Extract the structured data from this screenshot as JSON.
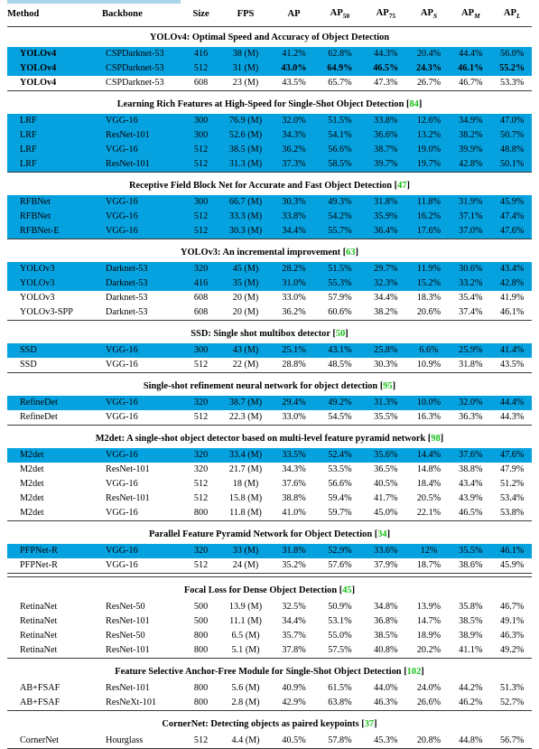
{
  "table": {
    "columns": [
      {
        "key": "method",
        "label": "Method",
        "align": "left"
      },
      {
        "key": "backbone",
        "label": "Backbone",
        "align": "left"
      },
      {
        "key": "size",
        "label": "Size",
        "align": "center"
      },
      {
        "key": "fps",
        "label": "FPS",
        "align": "center"
      },
      {
        "key": "ap",
        "label": "AP",
        "align": "center"
      },
      {
        "key": "ap50",
        "label": "AP",
        "sub": "50",
        "align": "center"
      },
      {
        "key": "ap75",
        "label": "AP",
        "sub": "75",
        "align": "center"
      },
      {
        "key": "aps",
        "label": "AP",
        "sub_italic": "S",
        "align": "center"
      },
      {
        "key": "apm",
        "label": "AP",
        "sub_italic": "M",
        "align": "center"
      },
      {
        "key": "apl",
        "label": "AP",
        "sub_italic": "L",
        "align": "center"
      }
    ],
    "sections": [
      {
        "title": "YOLOv4: Optimal Speed and Accuracy of Object Detection",
        "citation": "",
        "rows": [
          {
            "method": "YOLOv4",
            "backbone": "CSPDarknet-53",
            "size": "416",
            "fps": "38 (M)",
            "ap": "41.2%",
            "ap50": "62.8%",
            "ap75": "44.3%",
            "aps": "20.4%",
            "apm": "44.4%",
            "apl": "56.0%",
            "highlight": true,
            "bold": "method"
          },
          {
            "method": "YOLOv4",
            "backbone": "CSPDarknet-53",
            "size": "512",
            "fps": "31 (M)",
            "ap": "43.0%",
            "ap50": "64.9%",
            "ap75": "46.5%",
            "aps": "24.3%",
            "apm": "46.1%",
            "apl": "55.2%",
            "highlight": true,
            "bold": "all"
          },
          {
            "method": "YOLOv4",
            "backbone": "CSPDarknet-53",
            "size": "608",
            "fps": "23 (M)",
            "ap": "43.5%",
            "ap50": "65.7%",
            "ap75": "47.3%",
            "aps": "26.7%",
            "apm": "46.7%",
            "apl": "53.3%",
            "highlight": false,
            "bold": "method"
          }
        ]
      },
      {
        "title": "Learning Rich Features at High-Speed for Single-Shot Object Detection",
        "citation": "84",
        "rows": [
          {
            "method": "LRF",
            "backbone": "VGG-16",
            "size": "300",
            "fps": "76.9 (M)",
            "ap": "32.0%",
            "ap50": "51.5%",
            "ap75": "33.8%",
            "aps": "12.6%",
            "apm": "34.9%",
            "apl": "47.0%",
            "highlight": true
          },
          {
            "method": "LRF",
            "backbone": "ResNet-101",
            "size": "300",
            "fps": "52.6 (M)",
            "ap": "34.3%",
            "ap50": "54.1%",
            "ap75": "36.6%",
            "aps": "13.2%",
            "apm": "38.2%",
            "apl": "50.7%",
            "highlight": true
          },
          {
            "method": "LRF",
            "backbone": "VGG-16",
            "size": "512",
            "fps": "38.5 (M)",
            "ap": "36.2%",
            "ap50": "56.6%",
            "ap75": "38.7%",
            "aps": "19.0%",
            "apm": "39.9%",
            "apl": "48.8%",
            "highlight": true
          },
          {
            "method": "LRF",
            "backbone": "ResNet-101",
            "size": "512",
            "fps": "31.3 (M)",
            "ap": "37.3%",
            "ap50": "58.5%",
            "ap75": "39.7%",
            "aps": "19.7%",
            "apm": "42.8%",
            "apl": "50.1%",
            "highlight": true
          }
        ]
      },
      {
        "title": "Receptive Field Block Net for Accurate and Fast Object Detection",
        "citation": "47",
        "rows": [
          {
            "method": "RFBNet",
            "backbone": "VGG-16",
            "size": "300",
            "fps": "66.7 (M)",
            "ap": "30.3%",
            "ap50": "49.3%",
            "ap75": "31.8%",
            "aps": "11.8%",
            "apm": "31.9%",
            "apl": "45.9%",
            "highlight": true
          },
          {
            "method": "RFBNet",
            "backbone": "VGG-16",
            "size": "512",
            "fps": "33.3 (M)",
            "ap": "33.8%",
            "ap50": "54.2%",
            "ap75": "35.9%",
            "aps": "16.2%",
            "apm": "37.1%",
            "apl": "47.4%",
            "highlight": true
          },
          {
            "method": "RFBNet-E",
            "backbone": "VGG-16",
            "size": "512",
            "fps": "30.3 (M)",
            "ap": "34.4%",
            "ap50": "55.7%",
            "ap75": "36.4%",
            "aps": "17.6%",
            "apm": "37.0%",
            "apl": "47.6%",
            "highlight": true
          }
        ]
      },
      {
        "title": "YOLOv3: An incremental improvement",
        "citation": "63",
        "rows": [
          {
            "method": "YOLOv3",
            "backbone": "Darknet-53",
            "size": "320",
            "fps": "45 (M)",
            "ap": "28.2%",
            "ap50": "51.5%",
            "ap75": "29.7%",
            "aps": "11.9%",
            "apm": "30.6%",
            "apl": "43.4%",
            "highlight": true
          },
          {
            "method": "YOLOv3",
            "backbone": "Darknet-53",
            "size": "416",
            "fps": "35 (M)",
            "ap": "31.0%",
            "ap50": "55.3%",
            "ap75": "32.3%",
            "aps": "15.2%",
            "apm": "33.2%",
            "apl": "42.8%",
            "highlight": true
          },
          {
            "method": "YOLOv3",
            "backbone": "Darknet-53",
            "size": "608",
            "fps": "20 (M)",
            "ap": "33.0%",
            "ap50": "57.9%",
            "ap75": "34.4%",
            "aps": "18.3%",
            "apm": "35.4%",
            "apl": "41.9%",
            "highlight": false
          },
          {
            "method": "YOLOv3-SPP",
            "backbone": "Darknet-53",
            "size": "608",
            "fps": "20 (M)",
            "ap": "36.2%",
            "ap50": "60.6%",
            "ap75": "38.2%",
            "aps": "20.6%",
            "apm": "37.4%",
            "apl": "46.1%",
            "highlight": false
          }
        ]
      },
      {
        "title": "SSD: Single shot multibox detector",
        "citation": "50",
        "rows": [
          {
            "method": "SSD",
            "backbone": "VGG-16",
            "size": "300",
            "fps": "43 (M)",
            "ap": "25.1%",
            "ap50": "43.1%",
            "ap75": "25.8%",
            "aps": "6.6%",
            "apm": "25.9%",
            "apl": "41.4%",
            "highlight": true
          },
          {
            "method": "SSD",
            "backbone": "VGG-16",
            "size": "512",
            "fps": "22 (M)",
            "ap": "28.8%",
            "ap50": "48.5%",
            "ap75": "30.3%",
            "aps": "10.9%",
            "apm": "31.8%",
            "apl": "43.5%",
            "highlight": false
          }
        ]
      },
      {
        "title": "Single-shot refinement neural network for object detection",
        "citation": "95",
        "rows": [
          {
            "method": "RefineDet",
            "backbone": "VGG-16",
            "size": "320",
            "fps": "38.7 (M)",
            "ap": "29.4%",
            "ap50": "49.2%",
            "ap75": "31.3%",
            "aps": "10.0%",
            "apm": "32.0%",
            "apl": "44.4%",
            "highlight": true
          },
          {
            "method": "RefineDet",
            "backbone": "VGG-16",
            "size": "512",
            "fps": "22.3 (M)",
            "ap": "33.0%",
            "ap50": "54.5%",
            "ap75": "35.5%",
            "aps": "16.3%",
            "apm": "36.3%",
            "apl": "44.3%",
            "highlight": false
          }
        ]
      },
      {
        "title": "M2det: A single-shot object detector based on multi-level feature pyramid network",
        "citation": "98",
        "rows": [
          {
            "method": "M2det",
            "backbone": "VGG-16",
            "size": "320",
            "fps": "33.4 (M)",
            "ap": "33.5%",
            "ap50": "52.4%",
            "ap75": "35.6%",
            "aps": "14.4%",
            "apm": "37.6%",
            "apl": "47.6%",
            "highlight": true
          },
          {
            "method": "M2det",
            "backbone": "ResNet-101",
            "size": "320",
            "fps": "21.7 (M)",
            "ap": "34.3%",
            "ap50": "53.5%",
            "ap75": "36.5%",
            "aps": "14.8%",
            "apm": "38.8%",
            "apl": "47.9%",
            "highlight": false
          },
          {
            "method": "M2det",
            "backbone": "VGG-16",
            "size": "512",
            "fps": "18 (M)",
            "ap": "37.6%",
            "ap50": "56.6%",
            "ap75": "40.5%",
            "aps": "18.4%",
            "apm": "43.4%",
            "apl": "51.2%",
            "highlight": false
          },
          {
            "method": "M2det",
            "backbone": "ResNet-101",
            "size": "512",
            "fps": "15.8 (M)",
            "ap": "38.8%",
            "ap50": "59.4%",
            "ap75": "41.7%",
            "aps": "20.5%",
            "apm": "43.9%",
            "apl": "53.4%",
            "highlight": false
          },
          {
            "method": "M2det",
            "backbone": "VGG-16",
            "size": "800",
            "fps": "11.8 (M)",
            "ap": "41.0%",
            "ap50": "59.7%",
            "ap75": "45.0%",
            "aps": "22.1%",
            "apm": "46.5%",
            "apl": "53.8%",
            "highlight": false
          }
        ]
      },
      {
        "title": "Parallel Feature Pyramid Network for Object Detection",
        "citation": "34",
        "rows": [
          {
            "method": "PFPNet-R",
            "backbone": "VGG-16",
            "size": "320",
            "fps": "33 (M)",
            "ap": "31.8%",
            "ap50": "52.9%",
            "ap75": "33.6%",
            "aps": "12%",
            "apm": "35.5%",
            "apl": "46.1%",
            "highlight": true
          },
          {
            "method": "PFPNet-R",
            "backbone": "VGG-16",
            "size": "512",
            "fps": "24 (M)",
            "ap": "35.2%",
            "ap50": "57.6%",
            "ap75": "37.9%",
            "aps": "18.7%",
            "apm": "38.6%",
            "apl": "45.9%",
            "highlight": false
          }
        ]
      },
      {
        "title": "Focal Loss for Dense Object Detection",
        "citation": "45",
        "double_rule": true,
        "rows": [
          {
            "method": "RetinaNet",
            "backbone": "ResNet-50",
            "size": "500",
            "fps": "13.9 (M)",
            "ap": "32.5%",
            "ap50": "50.9%",
            "ap75": "34.8%",
            "aps": "13.9%",
            "apm": "35.8%",
            "apl": "46.7%",
            "highlight": false
          },
          {
            "method": "RetinaNet",
            "backbone": "ResNet-101",
            "size": "500",
            "fps": "11.1 (M)",
            "ap": "34.4%",
            "ap50": "53.1%",
            "ap75": "36.8%",
            "aps": "14.7%",
            "apm": "38.5%",
            "apl": "49.1%",
            "highlight": false
          },
          {
            "method": "RetinaNet",
            "backbone": "ResNet-50",
            "size": "800",
            "fps": "6.5 (M)",
            "ap": "35.7%",
            "ap50": "55.0%",
            "ap75": "38.5%",
            "aps": "18.9%",
            "apm": "38.9%",
            "apl": "46.3%",
            "highlight": false
          },
          {
            "method": "RetinaNet",
            "backbone": "ResNet-101",
            "size": "800",
            "fps": "5.1 (M)",
            "ap": "37.8%",
            "ap50": "57.5%",
            "ap75": "40.8%",
            "aps": "20.2%",
            "apm": "41.1%",
            "apl": "49.2%",
            "highlight": false
          }
        ]
      },
      {
        "title": "Feature Selective Anchor-Free Module for Single-Shot Object Detection",
        "citation": "102",
        "rows": [
          {
            "method": "AB+FSAF",
            "backbone": "ResNet-101",
            "size": "800",
            "fps": "5.6 (M)",
            "ap": "40.9%",
            "ap50": "61.5%",
            "ap75": "44.0%",
            "aps": "24.0%",
            "apm": "44.2%",
            "apl": "51.3%",
            "highlight": false
          },
          {
            "method": "AB+FSAF",
            "backbone": "ResNeXt-101",
            "size": "800",
            "fps": "2.8 (M)",
            "ap": "42.9%",
            "ap50": "63.8%",
            "ap75": "46.3%",
            "aps": "26.6%",
            "apm": "46.2%",
            "apl": "52.7%",
            "highlight": false
          }
        ]
      },
      {
        "title": "CornerNet: Detecting objects as paired keypoints",
        "citation": "37",
        "rows": [
          {
            "method": "CornerNet",
            "backbone": "Hourglass",
            "size": "512",
            "fps": "4.4 (M)",
            "ap": "40.5%",
            "ap50": "57.8%",
            "ap75": "45.3%",
            "aps": "20.8%",
            "apm": "44.8%",
            "apl": "56.7%",
            "highlight": false
          }
        ]
      }
    ]
  },
  "colors": {
    "highlight_row": "#06a2e0",
    "selection_strip": "#a9d3e8",
    "citation_green": "#16c116",
    "rule": "#3a3a3a",
    "text": "#000000"
  }
}
